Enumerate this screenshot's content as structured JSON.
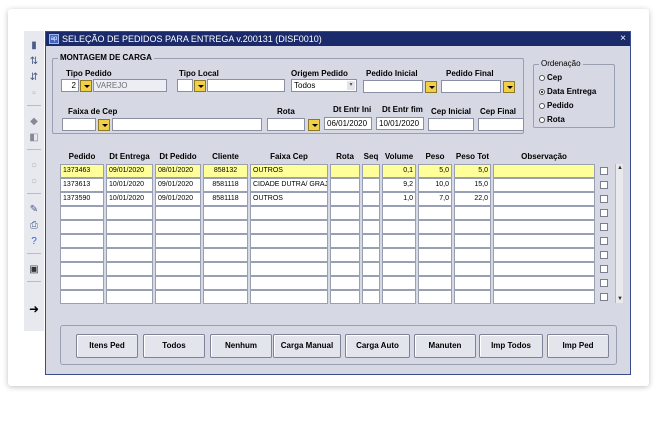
{
  "window": {
    "title": "SELEÇÃO DE PEDIDOS PARA ENTREGA v.200131 (DISF0010)",
    "close_glyph": "×",
    "app_icon": "ap"
  },
  "section": {
    "title": "MONTAGEM DE CARGA"
  },
  "filters": {
    "tipo_pedido": {
      "label": "Tipo Pedido",
      "code": "2",
      "desc": "VAREJO"
    },
    "tipo_local": {
      "label": "Tipo Local",
      "value": ""
    },
    "origem_pedido": {
      "label": "Origem Pedido",
      "value": "Todos"
    },
    "pedido_inicial": {
      "label": "Pedido Inicial",
      "value": ""
    },
    "pedido_final": {
      "label": "Pedido Final",
      "value": ""
    },
    "faixa_cep": {
      "label": "Faixa de Cep",
      "value": ""
    },
    "rota": {
      "label": "Rota",
      "value": ""
    },
    "dt_entr_ini": {
      "label": "Dt Entr Ini",
      "value": "06/01/2020"
    },
    "dt_entr_fim": {
      "label": "Dt Entr fim",
      "value": "10/01/2020"
    },
    "cep_inicial": {
      "label": "Cep Inicial",
      "value": ""
    },
    "cep_final": {
      "label": "Cep Final",
      "value": ""
    }
  },
  "ordenacao": {
    "title": "Ordenação",
    "options": [
      "Cep",
      "Data Entrega",
      "Pedido",
      "Rota"
    ],
    "selected": "Data Entrega"
  },
  "grid": {
    "headers": [
      "Pedido",
      "Dt Entrega",
      "Dt Pedido",
      "Cliente",
      "Faixa Cep",
      "Rota",
      "Seq",
      "Volume",
      "Peso",
      "Peso Tot",
      "Observação"
    ],
    "rows": [
      [
        "1373463",
        "09/01/2020",
        "08/01/2020",
        "858132",
        "OUTROS",
        "",
        "",
        "0,1",
        "5,0",
        "5,0",
        ""
      ],
      [
        "1373613",
        "10/01/2020",
        "09/01/2020",
        "8581118",
        "CIDADE DUTRA/ GRAJ",
        "",
        "",
        "9,2",
        "10,0",
        "15,0",
        ""
      ],
      [
        "1373590",
        "10/01/2020",
        "09/01/2020",
        "8581118",
        "OUTROS",
        "",
        "",
        "1,0",
        "7,0",
        "22,0",
        ""
      ]
    ],
    "empty_rows": 7,
    "selected_row": 0
  },
  "buttons": [
    "Itens Ped",
    "Todos",
    "Nenhum",
    "Carga Manual",
    "Carga Auto",
    "Manuten",
    "Imp Todos",
    "Imp Ped"
  ],
  "colors": {
    "titlebar": "#1b2a6b",
    "window_bg": "#d6d8e3",
    "dropdown": "#f1cf49",
    "selected_row": "#ffff99"
  }
}
